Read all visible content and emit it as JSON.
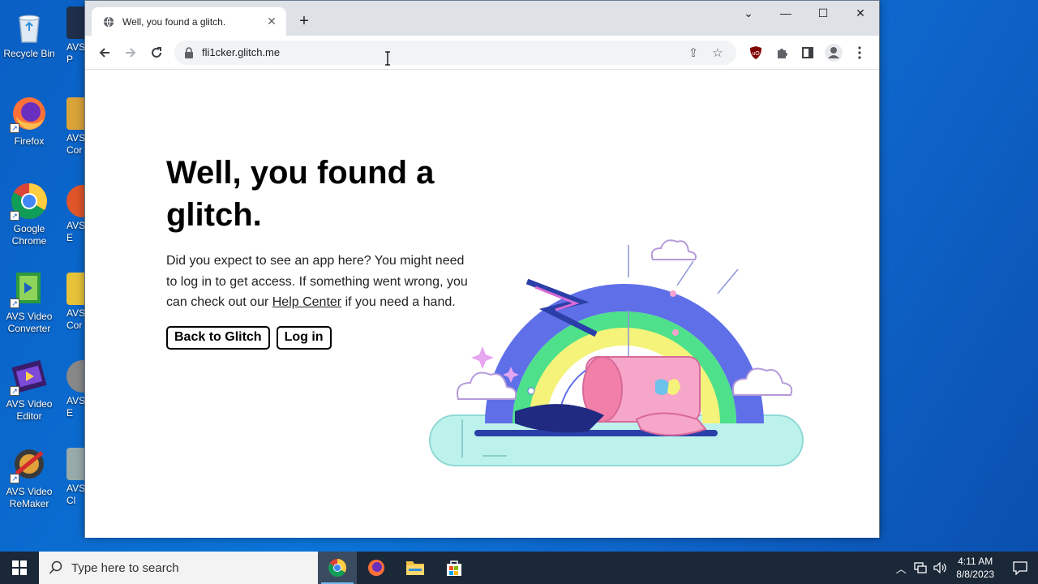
{
  "desktop": {
    "icons": [
      {
        "label": "Recycle Bin"
      },
      {
        "label": "Firefox"
      },
      {
        "label": "Google Chrome"
      },
      {
        "label": "AVS Video Converter"
      },
      {
        "label": "AVS Video Editor"
      },
      {
        "label": "AVS Video ReMaker"
      }
    ],
    "partial_icons": [
      {
        "label": "AVS P"
      },
      {
        "label": "AVS Cor"
      },
      {
        "label": "AVS E"
      },
      {
        "label": "AVS Cor"
      },
      {
        "label": "AVS E"
      },
      {
        "label": "AVS I Cl"
      }
    ]
  },
  "browser": {
    "tab_title": "Well, you found a glitch.",
    "url": "fli1cker.glitch.me",
    "icons": {
      "back": "back-arrow-icon",
      "forward": "forward-arrow-icon",
      "reload": "reload-icon",
      "lock": "lock-icon",
      "share": "share-icon",
      "star": "bookmark-star-icon",
      "ublock": "ublock-origin-icon",
      "extensions": "puzzle-icon",
      "sidepanel": "side-panel-icon",
      "profile": "profile-icon",
      "menu": "kebab-menu-icon"
    }
  },
  "page": {
    "headline": "Well, you found a glitch.",
    "desc_part1": "Did you expect to see an app here? You might need to log in to get access. If something went wrong, you can check out our ",
    "help_link": "Help Center",
    "desc_part2": " if you need a hand.",
    "back_button": "Back to Glitch",
    "login_button": "Log in"
  },
  "taskbar": {
    "search_placeholder": "Type here to search",
    "time": "4:11 AM",
    "date": "8/8/2023",
    "apps": [
      "Google Chrome",
      "Firefox",
      "File Explorer",
      "Microsoft Store"
    ]
  },
  "colors": {
    "desktop_bg": "#0b74d8",
    "taskbar_bg": "#1b2838",
    "tabstrip_bg": "#dee1e6",
    "ublock_red": "#800000"
  }
}
